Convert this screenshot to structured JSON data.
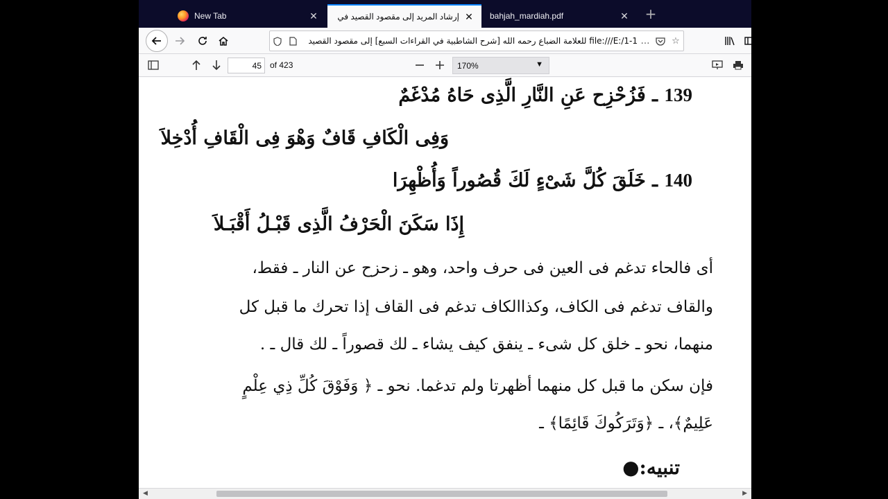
{
  "browser": {
    "tabs": [
      {
        "title": "New Tab",
        "active": false
      },
      {
        "title": "إرشاد المريد إلى مقصود القصيد في القرا",
        "active": true
      },
      {
        "title": "bahjah_mardiah.pdf",
        "active": false
      }
    ],
    "url": "file:///E:/1-1 للعلامة الضباع رحمه الله [شرح الشاطبية في القراءات السبع] إلى مقصود القصيد",
    "page_actions_icon": "…"
  },
  "pdf_toolbar": {
    "page_number": "45",
    "page_count": "of 423",
    "zoom": "170%"
  },
  "document": {
    "verses": [
      {
        "number": "139",
        "line1": "ـ فَزُحْزِح عَنِ النَّارِ الَّذِى حَاهُ مُدْغَمٌ",
        "line2": "وَفِى الْكَافِ قَافٌ وَهْوَ فِى الْقَافِ أُدْخِلاَ"
      },
      {
        "number": "140",
        "line1": "ـ خَلَقَ كُلَّ شَىْءٍ لَكَ قُصُوراً وَأُظْهِرَا",
        "line2": "إِذَا سَكَنَ الْحَرْفُ الَّذِى قَبْـلُ أَقْبَـلاَ"
      }
    ],
    "paragraph1": [
      "أى فالحاء تدغم فى العين فى حرف واحد، وهو ـ زحزح عن النار ـ فقط،",
      "والقاف تدغم فى الكاف، وكذاالكاف تدغم فى القاف إذا تحرك ما قبل كل",
      "منهما، نحو ـ خلق كل شىء ـ ينفق كيف يشاء ـ لك قصوراً ـ لك قال ـ ."
    ],
    "paragraph2": [
      "فإن سكن ما قبل كل منهما أظهرتا ولم تدغما. نحو ـ ﴿ وَفَوْقَ كُلِّ ذِي عِلْمٍ",
      "عَلِيمٌ﴾، ـ ﴿وَتَرَكُوكَ قَائِمًا﴾ ـ"
    ],
    "heading": "تنبيه:"
  },
  "colors": {
    "tabstrip": "#0c0c2a",
    "accent": "#0a84ff"
  }
}
